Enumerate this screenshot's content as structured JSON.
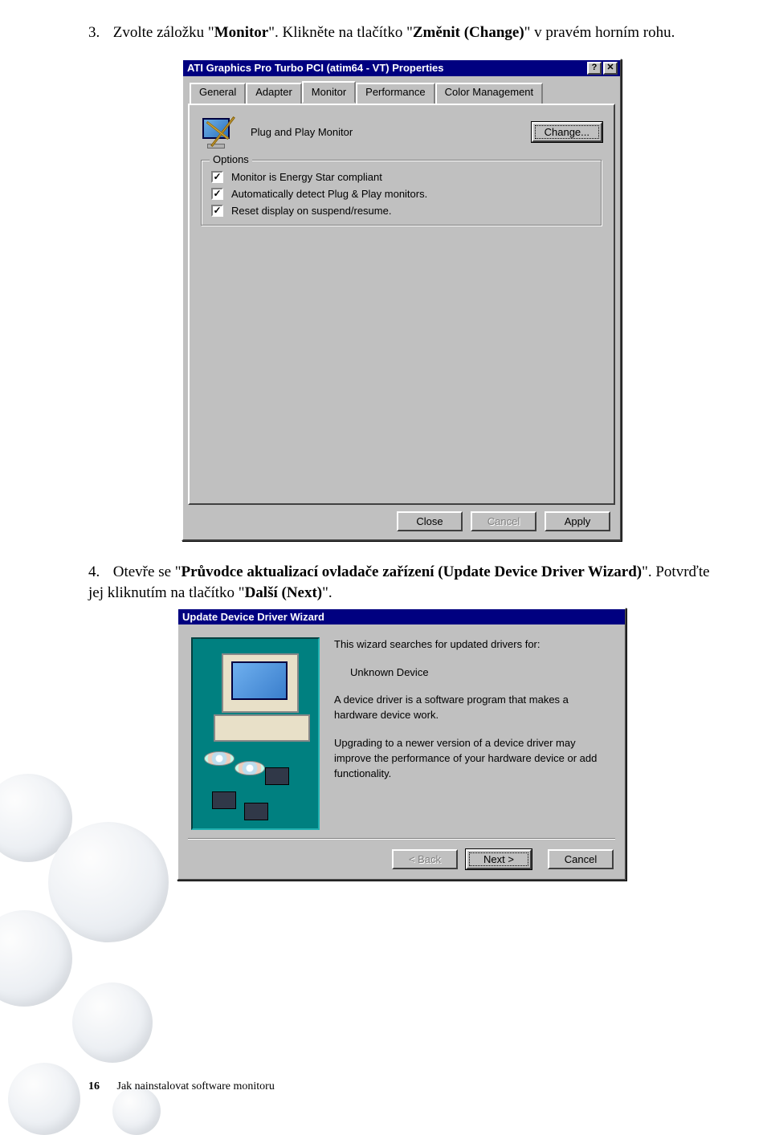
{
  "step3": {
    "num": "3.",
    "t1": "Zvolte záložku \"",
    "b1": "Monitor",
    "t2": "\". Klikněte na tlačítko \"",
    "b2": "Změnit (Change)",
    "t3": "\" v pravém horním rohu."
  },
  "step4": {
    "num": "4.",
    "t1": "Otevře se \"",
    "b1": "Průvodce aktualizací ovladače zařízení (Update Device Driver Wizard)",
    "t2": "\". Potvrďte jej kliknutím na tlačítko \"",
    "b2": "Další (Next)",
    "t3": "\"."
  },
  "propWin": {
    "title": "ATI Graphics Pro Turbo PCI (atim64 - VT) Properties",
    "helpGlyph": "?",
    "closeGlyph": "✕",
    "tabs": {
      "general": "General",
      "adapter": "Adapter",
      "monitor": "Monitor",
      "performance": "Performance",
      "colormgmt": "Color Management"
    },
    "monitorLabel": "Plug and Play Monitor",
    "changeBtn": "Change...",
    "groupTitle": "Options",
    "opt1": "Monitor is Energy Star compliant",
    "opt2": "Automatically detect Plug & Play monitors.",
    "opt3": "Reset display on suspend/resume.",
    "checkGlyph": "✓",
    "btns": {
      "close": "Close",
      "cancel": "Cancel",
      "apply": "Apply"
    }
  },
  "wiz": {
    "title": "Update Device Driver Wizard",
    "p1": "This wizard searches for updated drivers for:",
    "device": "Unknown Device",
    "p2": "A device driver is a software program that makes a hardware device work.",
    "p3": "Upgrading to a newer version of a device driver may improve the performance of your hardware device or add functionality.",
    "btns": {
      "back": "< Back",
      "next": "Next >",
      "cancel": "Cancel"
    }
  },
  "footer": {
    "page": "16",
    "section": "Jak nainstalovat software monitoru"
  }
}
